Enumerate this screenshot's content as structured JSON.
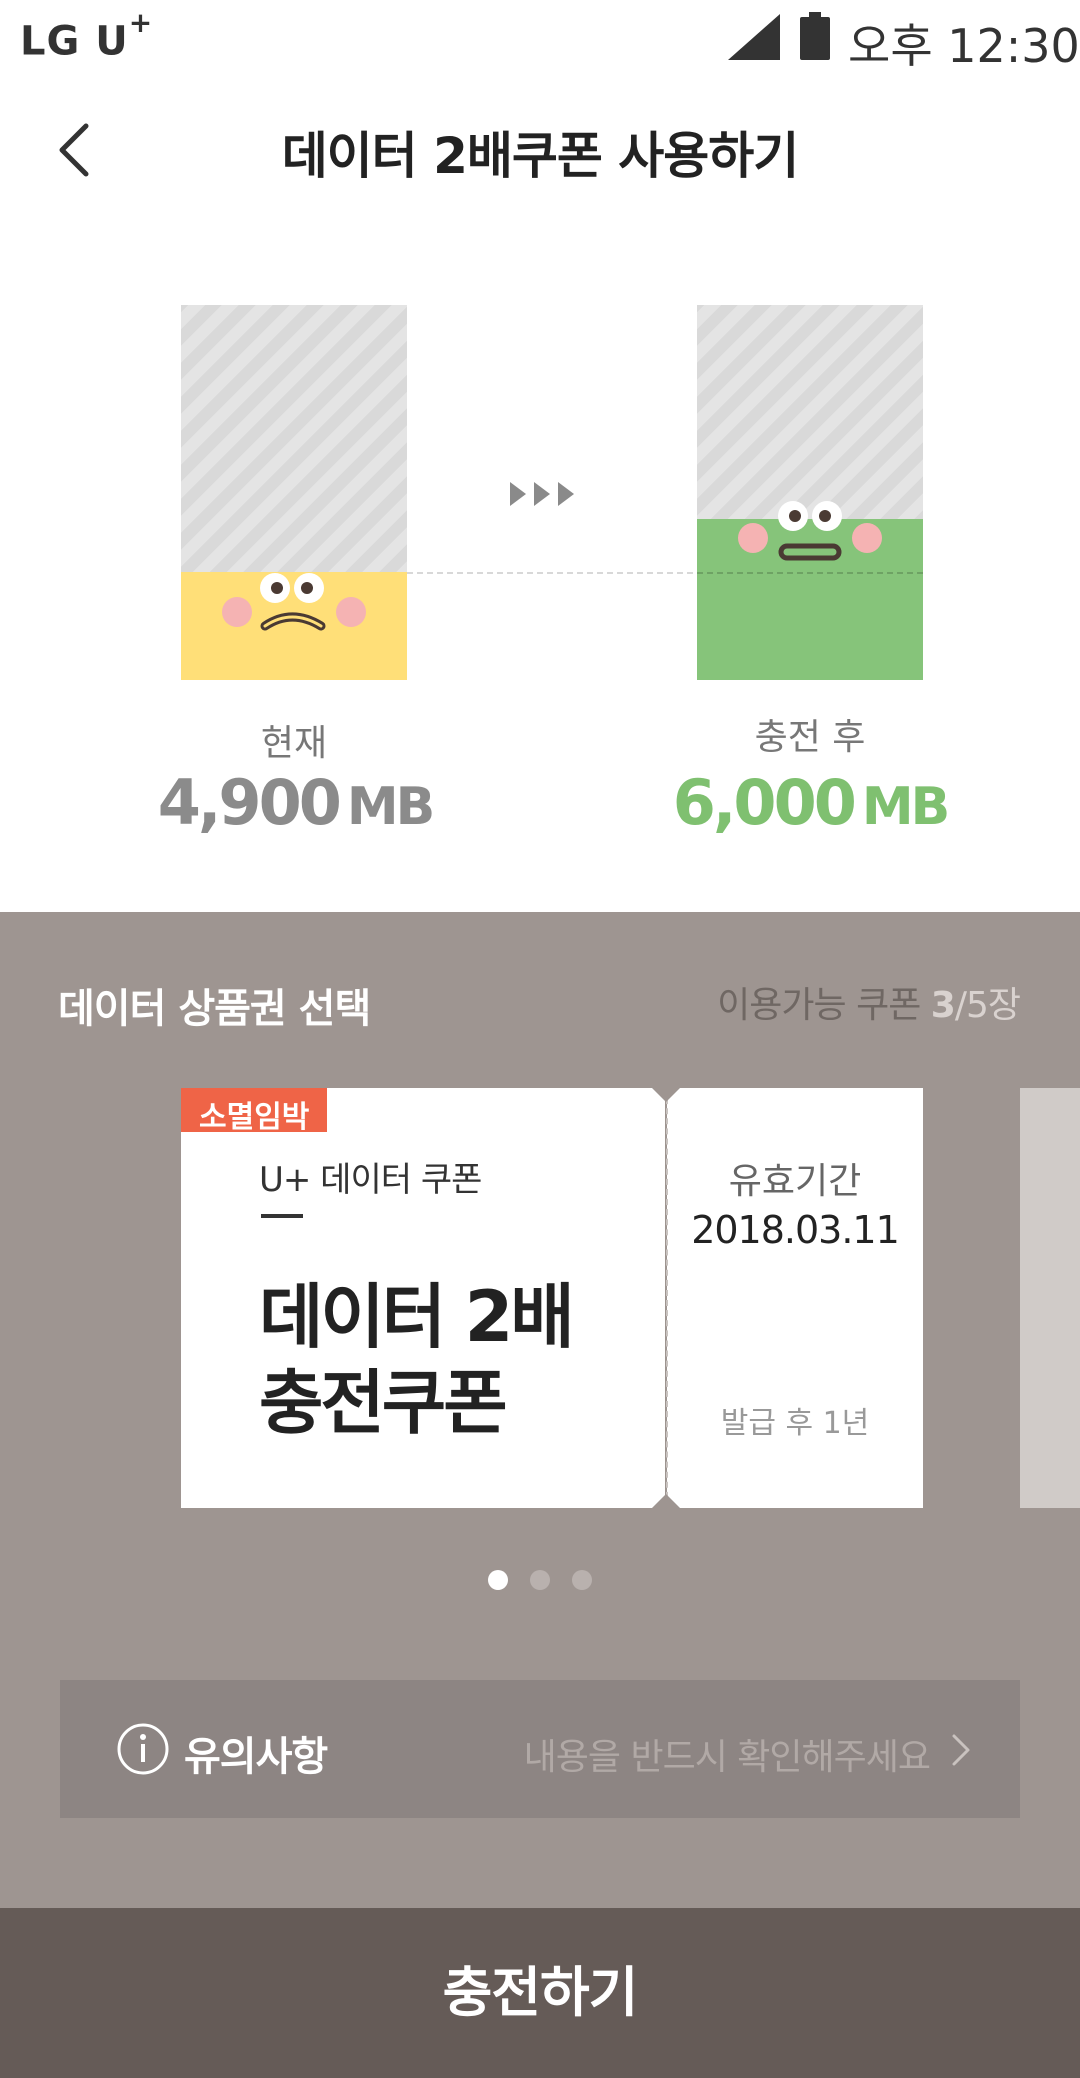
{
  "status_bar": {
    "carrier": "LG U",
    "carrier_plus": "+",
    "time": "오후 12:30",
    "icons": [
      "signal-icon",
      "battery-icon"
    ]
  },
  "header": {
    "title": "데이터 2배쿠폰 사용하기",
    "back_icon": "chevron-left-icon"
  },
  "data_compare": {
    "current_label": "현재",
    "current_value": "4,900",
    "current_unit": "MB",
    "after_label": "충전 후",
    "after_value": "6,000",
    "after_unit": "MB",
    "current_color": "#ffdf78",
    "after_color": "#86c47a"
  },
  "coupon_section": {
    "title": "데이터 상품권 선택",
    "available_label": "이용가능 쿠폰",
    "available_count": "3",
    "available_total": "/5장",
    "coupon": {
      "badge": "소멸임박",
      "subtitle": "U+ 데이터 쿠폰",
      "name_line1": "데이터 2배",
      "name_line2": "충전쿠폰",
      "valid_label": "유효기간",
      "valid_date": "2018.03.11",
      "valid_note": "발급 후 1년"
    },
    "pagination": {
      "pages": 3,
      "active": 1
    }
  },
  "notice": {
    "icon": "info-icon",
    "title": "유의사항",
    "message": "내용을 반드시 확인해주세요",
    "chevron_icon": "chevron-right-icon"
  },
  "action": {
    "charge_label": "충전하기",
    "button_color": "#655b57",
    "badge_color": "#ef6447"
  }
}
